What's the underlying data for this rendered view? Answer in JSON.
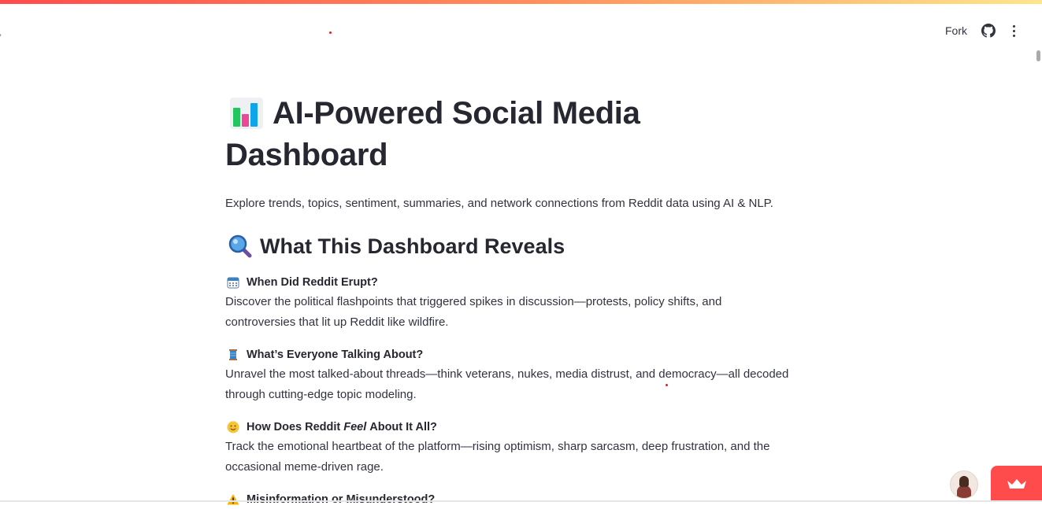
{
  "header": {
    "fork_label": "Fork",
    "icons": [
      "github-icon",
      "more-vertical-icon",
      "chevron-right-icon"
    ]
  },
  "page": {
    "title_line1": "AI-Powered Social Media",
    "title_line2": "Dashboard",
    "title_icon": "bar-chart-icon",
    "description": "Explore trends, topics, sentiment, summaries, and network connections from Reddit data using AI & NLP.",
    "subheading": "What This Dashboard Reveals",
    "subheading_icon": "magnifying-glass-icon"
  },
  "sections": [
    {
      "icon": "calendar-icon",
      "title": "When Did Reddit Erupt?",
      "body": "Discover the political flashpoints that triggered spikes in discussion—protests, policy shifts, and controversies that lit up Reddit like wildfire."
    },
    {
      "icon": "spool-icon",
      "title": "What’s Everyone Talking About?",
      "body": "Unravel the most talked-about threads—think veterans, nukes, media distrust, and democracy—all decoded through cutting-edge topic modeling."
    },
    {
      "icon": "smiling-face-icon",
      "title_before": "How Does Reddit",
      "title_em": "Feel",
      "title_after": "About It All?",
      "body": "Track the emotional heartbeat of the platform—rising optimism, sharp sarcasm, deep frustration, and the occasional meme-driven rage."
    },
    {
      "icon": "warning-icon",
      "title": "Misinformation or Misunderstood?"
    }
  ],
  "colors": {
    "accent": "#ff4b4b",
    "text": "#31333f",
    "heading": "#262730"
  }
}
